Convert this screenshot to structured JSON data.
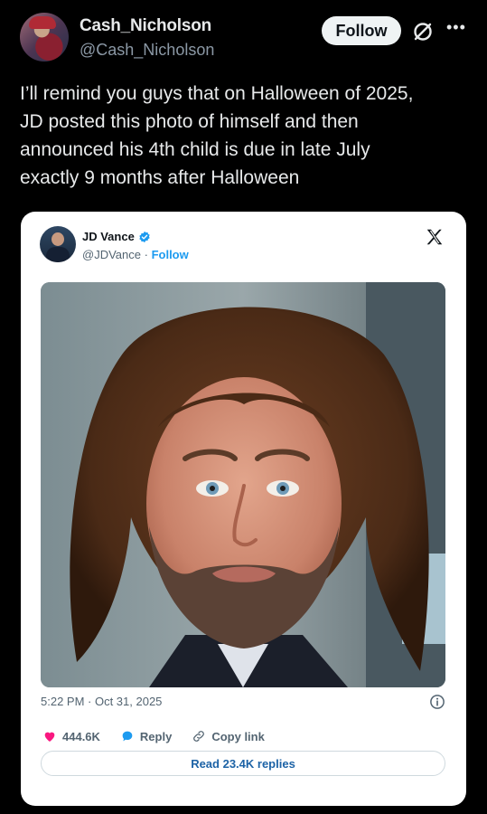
{
  "tweet": {
    "author": {
      "name": "Cash_Nicholson",
      "handle": "@Cash_Nicholson"
    },
    "follow_label": "Follow",
    "icons": {
      "grok": "grok-icon",
      "more": "more-icon"
    },
    "text_lines": [
      "I’ll remind you guys that on Halloween of 2025,",
      "JD posted this photo of himself and then",
      "announced his 4th child is due in late July",
      "exactly 9 months after Halloween"
    ]
  },
  "embed": {
    "author": {
      "name": "JD Vance",
      "handle": "@JDVance",
      "separator": "·",
      "follow_label": "Follow"
    },
    "icons": {
      "verified": "verified-badge-icon",
      "platform": "x-logo-icon",
      "info": "info-icon"
    },
    "timestamp": "5:22 PM · Oct 31, 2025",
    "actions": {
      "likes": "444.6K",
      "reply_label": "Reply",
      "copy_link_label": "Copy link"
    },
    "read_replies_label": "Read 23.4K replies",
    "colors": {
      "like": "#f91880",
      "reply": "#1d9bf0",
      "link": "#1d9bf0",
      "verified": "#1d9bf0"
    }
  }
}
